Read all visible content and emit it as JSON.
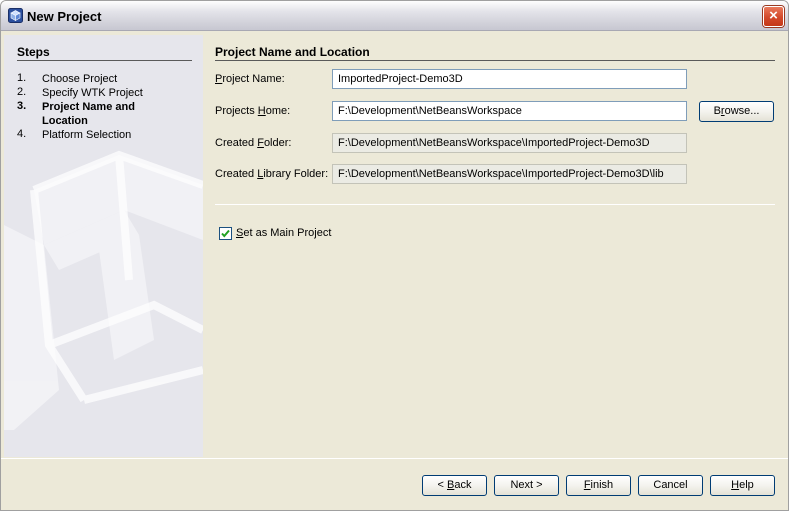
{
  "window": {
    "title": "New Project",
    "close_label": "×"
  },
  "steps": {
    "title": "Steps",
    "items": [
      {
        "num": "1.",
        "label": "Choose Project",
        "current": false
      },
      {
        "num": "2.",
        "label": "Specify WTK Project",
        "current": false
      },
      {
        "num": "3.",
        "label": "Project Name and Location",
        "current": true
      },
      {
        "num": "4.",
        "label": "Platform Selection",
        "current": false
      }
    ]
  },
  "panel": {
    "title": "Project Name and Location",
    "project_name": {
      "label_m": "P",
      "label_rest": "roject Name:",
      "value": "ImportedProject-Demo3D"
    },
    "projects_home": {
      "label_pre": "Projects ",
      "label_m": "H",
      "label_rest": "ome:",
      "value": "F:\\Development\\NetBeansWorkspace"
    },
    "browse_button": {
      "label_pre": "B",
      "label_m": "r",
      "label_rest": "owse..."
    },
    "created_folder": {
      "label_pre": "Created ",
      "label_m": "F",
      "label_rest": "older:",
      "value": "F:\\Development\\NetBeansWorkspace\\ImportedProject-Demo3D"
    },
    "created_library_folder": {
      "label_pre": "Created ",
      "label_m": "L",
      "label_rest": "ibrary Folder:",
      "value": "F:\\Development\\NetBeansWorkspace\\ImportedProject-Demo3D\\lib"
    },
    "main_project": {
      "label_m": "S",
      "label_rest": "et as Main Project",
      "checked": true
    }
  },
  "buttons": {
    "back": {
      "label_pre": "< ",
      "label_m": "B",
      "label_rest": "ack"
    },
    "next": {
      "label": "Next >"
    },
    "finish": {
      "label_m": "F",
      "label_rest": "inish"
    },
    "cancel": {
      "label": "Cancel"
    },
    "help": {
      "label_m": "H",
      "label_rest": "elp"
    }
  },
  "colors": {
    "steps_bg": "#e6e6ec",
    "dialog_bg": "#ece9d8",
    "close_red": "#d3492b",
    "check_green": "#21a121"
  }
}
